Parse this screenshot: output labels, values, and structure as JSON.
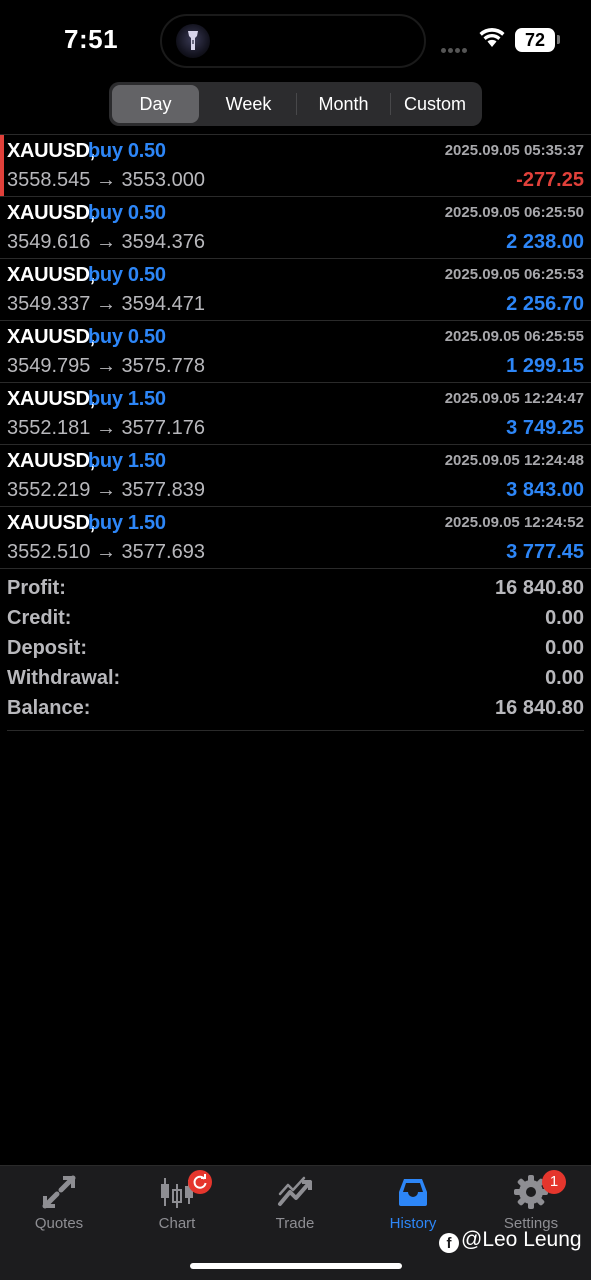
{
  "status": {
    "time": "7:51",
    "battery": "72"
  },
  "periods": {
    "items": [
      "Day",
      "Week",
      "Month",
      "Custom"
    ],
    "selected": "Day"
  },
  "deals": [
    {
      "symbol": "XAUUSD,",
      "type": "buy 0.50",
      "datetime": "2025.09.05 05:35:37",
      "prices": "3558.545 → 3553.000",
      "profit": "-277.25",
      "profit_sign": "negative"
    },
    {
      "symbol": "XAUUSD,",
      "type": "buy 0.50",
      "datetime": "2025.09.05 06:25:50",
      "prices": "3549.616 → 3594.376",
      "profit": "2 238.00",
      "profit_sign": "positive"
    },
    {
      "symbol": "XAUUSD,",
      "type": "buy 0.50",
      "datetime": "2025.09.05 06:25:53",
      "prices": "3549.337 → 3594.471",
      "profit": "2 256.70",
      "profit_sign": "positive"
    },
    {
      "symbol": "XAUUSD,",
      "type": "buy 0.50",
      "datetime": "2025.09.05 06:25:55",
      "prices": "3549.795 → 3575.778",
      "profit": "1 299.15",
      "profit_sign": "positive"
    },
    {
      "symbol": "XAUUSD,",
      "type": "buy 1.50",
      "datetime": "2025.09.05 12:24:47",
      "prices": "3552.181 → 3577.176",
      "profit": "3 749.25",
      "profit_sign": "positive"
    },
    {
      "symbol": "XAUUSD,",
      "type": "buy 1.50",
      "datetime": "2025.09.05 12:24:48",
      "prices": "3552.219 → 3577.839",
      "profit": "3 843.00",
      "profit_sign": "positive"
    },
    {
      "symbol": "XAUUSD,",
      "type": "buy 1.50",
      "datetime": "2025.09.05 12:24:52",
      "prices": "3552.510 → 3577.693",
      "profit": "3 777.45",
      "profit_sign": "positive"
    }
  ],
  "summary": [
    {
      "label": "Profit:",
      "value": "16 840.80"
    },
    {
      "label": "Credit:",
      "value": "0.00"
    },
    {
      "label": "Deposit:",
      "value": "0.00"
    },
    {
      "label": "Withdrawal:",
      "value": "0.00"
    },
    {
      "label": "Balance:",
      "value": "16 840.80"
    }
  ],
  "tabs": [
    {
      "label": "Quotes",
      "icon": "quotes-icon"
    },
    {
      "label": "Chart",
      "icon": "chart-candles-icon"
    },
    {
      "label": "Trade",
      "icon": "trade-icon"
    },
    {
      "label": "History",
      "icon": "history-inbox-icon",
      "active": true
    },
    {
      "label": "Settings",
      "icon": "gear-icon",
      "badge": "1"
    }
  ],
  "watermark": "@Leo Leung",
  "colors": {
    "accent_blue": "#2d86f7",
    "loss_red": "#e0403a",
    "badge_red": "#e5362d",
    "background": "#000000",
    "tabbar_bg": "#1c1c1e"
  }
}
